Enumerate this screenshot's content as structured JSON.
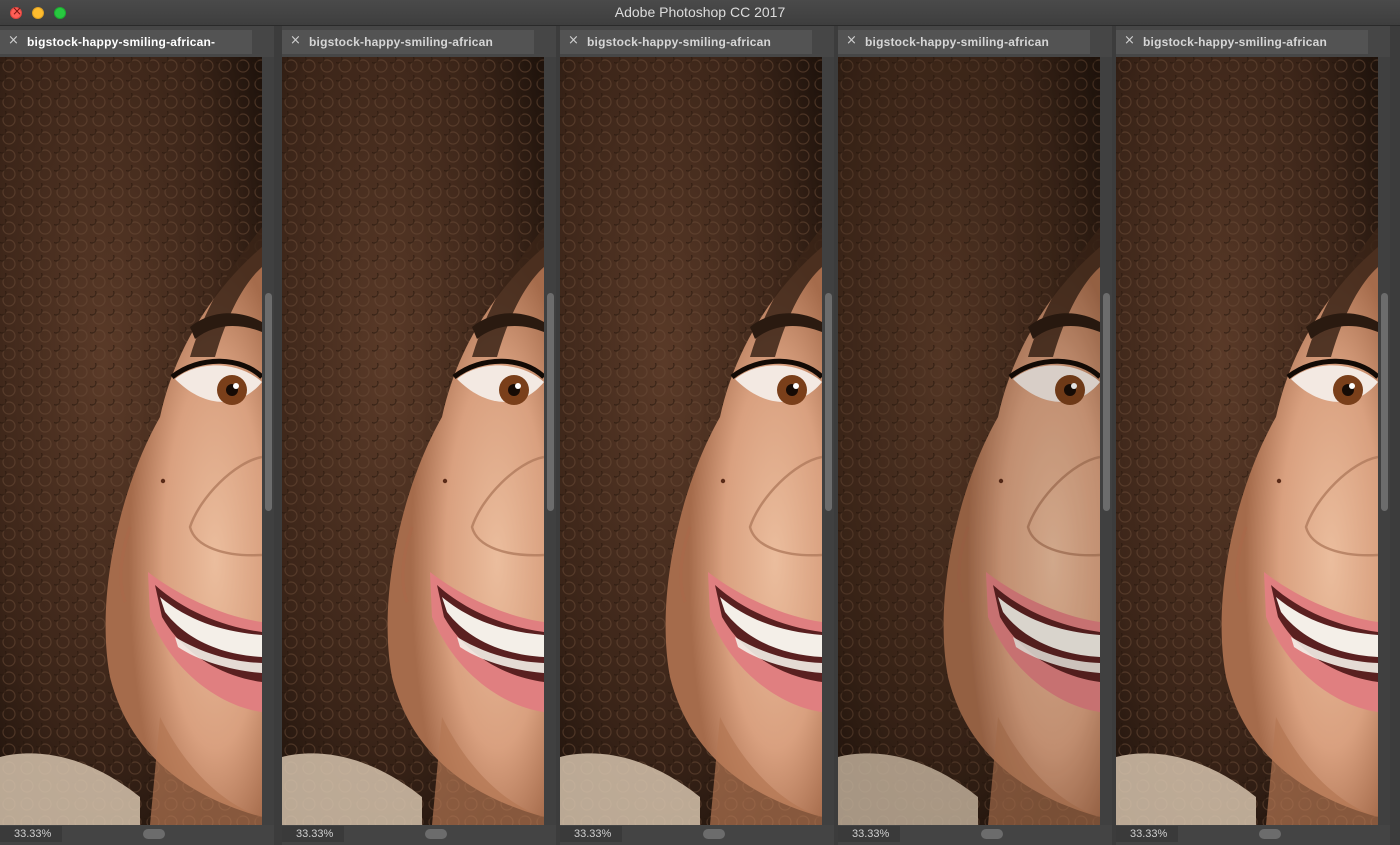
{
  "window": {
    "title": "Adobe Photoshop CC 2017"
  },
  "documents": [
    {
      "tab_label": "bigstock-happy-smiling-african-",
      "close_glyph": "×",
      "zoom": "33.33%"
    },
    {
      "tab_label": "bigstock-happy-smiling-african",
      "close_glyph": "×",
      "zoom": "33.33%"
    },
    {
      "tab_label": "bigstock-happy-smiling-african",
      "close_glyph": "×",
      "zoom": "33.33%"
    },
    {
      "tab_label": "bigstock-happy-smiling-african",
      "close_glyph": "×",
      "zoom": "33.33%"
    },
    {
      "tab_label": "bigstock-happy-smiling-african",
      "close_glyph": "×",
      "zoom": "33.33%"
    }
  ],
  "colors": {
    "hair": "#3a2418",
    "skin": "#d9a07f",
    "lips": "#e07f80",
    "teeth": "#f4efe8",
    "iris": "#7a3f1a"
  },
  "icons": {
    "traffic_close": "close-icon",
    "traffic_minimize": "minimize-icon",
    "traffic_zoom": "zoom-icon",
    "tab_close": "close-icon"
  }
}
